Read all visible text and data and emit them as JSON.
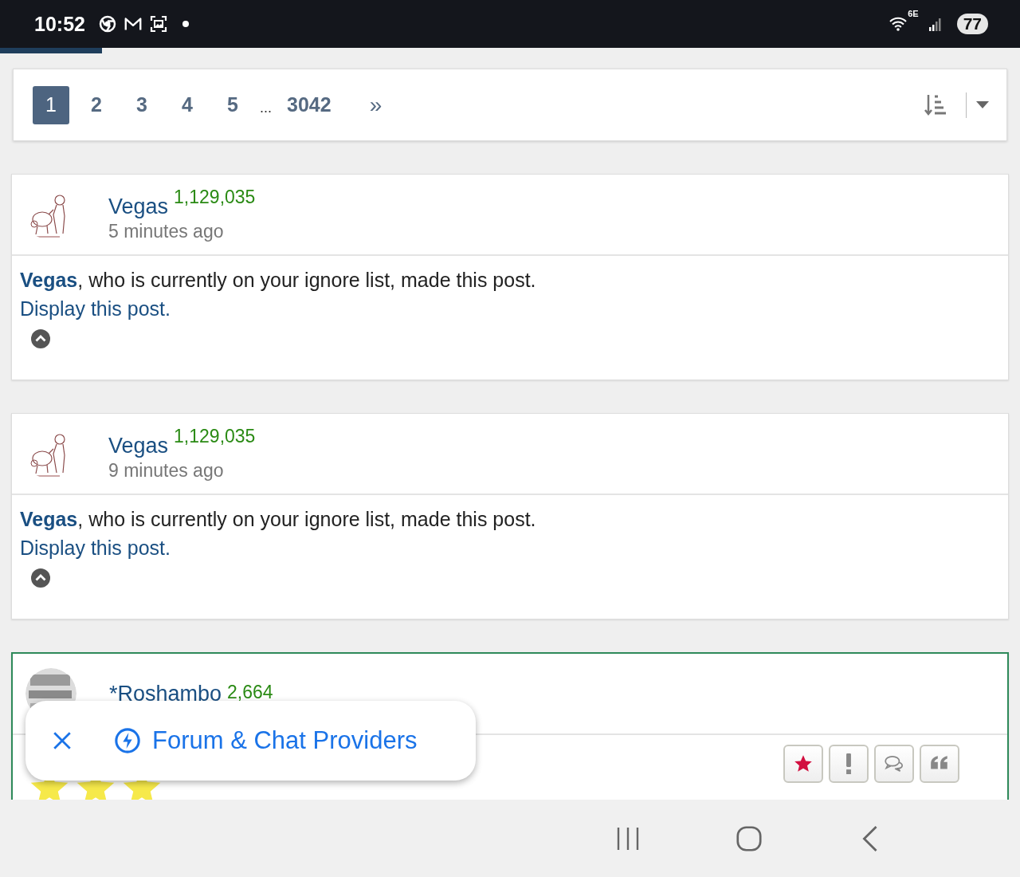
{
  "status_bar": {
    "time": "10:52",
    "wifi_label": "6E",
    "battery": "77"
  },
  "load_progress": {
    "level": 0.1
  },
  "pagination": {
    "items": [
      {
        "kind": "page",
        "label": "1",
        "selected": true
      },
      {
        "kind": "page",
        "label": "2",
        "selected": false
      },
      {
        "kind": "page",
        "label": "3",
        "selected": false
      },
      {
        "kind": "page",
        "label": "4",
        "selected": false
      },
      {
        "kind": "page",
        "label": "5",
        "selected": false
      },
      {
        "kind": "ellipsis",
        "label": "..."
      },
      {
        "kind": "page",
        "label": "3042",
        "selected": false
      },
      {
        "kind": "next",
        "label": "»"
      }
    ]
  },
  "posts": [
    {
      "kind": "ignored",
      "highlighted": false,
      "user": "Vegas",
      "score": "1,129,035",
      "time": "5 minutes ago",
      "notice": "**Vegas**, who is currently on your ignore list, made this post.",
      "link": "Display this post."
    },
    {
      "kind": "ignored",
      "highlighted": false,
      "user": "Vegas",
      "score": "1,129,035",
      "time": "9 minutes ago",
      "notice": "**Vegas**, who is currently on your ignore list, made this post.",
      "link": "Display this post."
    },
    {
      "kind": "normal",
      "highlighted": true,
      "user": "*Roshambo",
      "score": "2,664",
      "stars": 3,
      "actions": [
        {
          "kind": "favorite"
        },
        {
          "kind": "report"
        },
        {
          "kind": "reply"
        },
        {
          "kind": "quote"
        }
      ]
    }
  ],
  "toast": {
    "label": "Forum & Chat Providers"
  }
}
